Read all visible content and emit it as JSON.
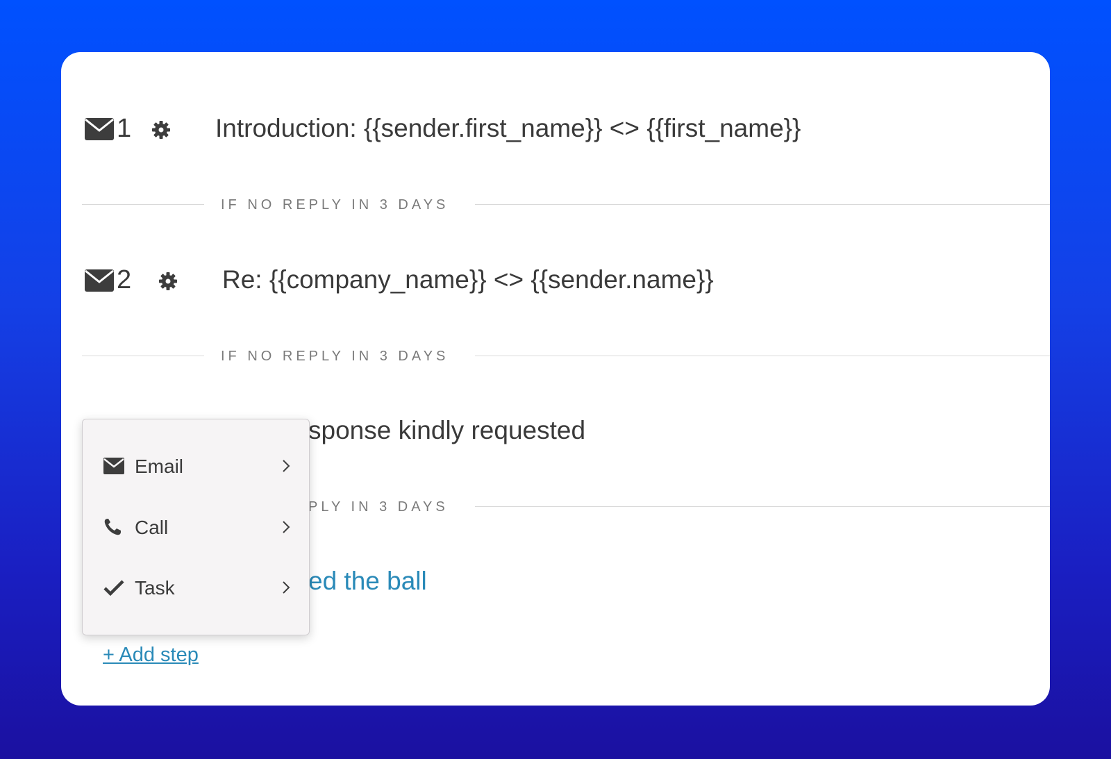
{
  "steps": [
    {
      "number": "1",
      "icon": "envelope-icon",
      "subject": "Introduction: {{sender.first_name}} <> {{first_name}}"
    },
    {
      "number": "2",
      "icon": "envelope-icon",
      "subject": "Re: {{company_name}} <> {{sender.name}}"
    },
    {
      "subject_visible": "sponse kindly requested"
    },
    {
      "subject_visible": "ed the ball",
      "color": "#2a8ab8"
    }
  ],
  "delays": [
    {
      "label": "IF NO REPLY IN 3 DAYS"
    },
    {
      "label": "IF NO REPLY IN 3 DAYS"
    },
    {
      "label_visible": "PLY IN 3 DAYS"
    }
  ],
  "menu": {
    "items": [
      {
        "label": "Email",
        "icon": "envelope-icon"
      },
      {
        "label": "Call",
        "icon": "phone-icon"
      },
      {
        "label": "Task",
        "icon": "checkmark-icon"
      }
    ]
  },
  "add_step": {
    "label": "+ Add step"
  },
  "colors": {
    "background_top": "#0051ff",
    "background_bottom": "#1b10a0",
    "link": "#2a8ab8",
    "text": "#3a3a3a",
    "muted": "#7a7a7a"
  }
}
